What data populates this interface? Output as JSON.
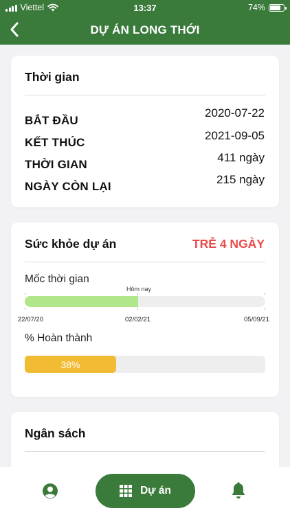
{
  "status_bar": {
    "carrier": "Viettel",
    "time": "13:37",
    "battery": "74%",
    "icons": [
      "signal-icon",
      "wifi-icon",
      "battery-icon"
    ]
  },
  "header": {
    "title": "DỰ ÁN LONG THỚI",
    "back_icon": "chevron-left-icon"
  },
  "time_card": {
    "title": "Thời gian",
    "rows": [
      {
        "label": "BẮT ĐẦU",
        "value": "2020-07-22"
      },
      {
        "label": "KẾT THÚC",
        "value": "2021-09-05"
      },
      {
        "label": "THỜI GIAN",
        "value": "411 ngày"
      },
      {
        "label": "NGÀY CÒN LẠI",
        "value": "215 ngày"
      }
    ]
  },
  "health_card": {
    "title": "Sức khỏe dự án",
    "status": "TRỄ 4 NGÀY",
    "timeline": {
      "label": "Mốc thời gian",
      "today_label": "Hôm nay",
      "start_date": "22/07/20",
      "today_date": "02/02/21",
      "end_date": "05/09/21",
      "elapsed_fraction": 0.47
    },
    "completion": {
      "label": "% Hoàn thành",
      "value_text": "38%",
      "percent": 38
    }
  },
  "budget_card": {
    "title": "Ngân sách"
  },
  "bottom_nav": {
    "projects_label": "Dự án",
    "icons": [
      "profile-icon",
      "grid-icon",
      "bell-icon"
    ]
  },
  "colors": {
    "primary_green": "#3a7a3a",
    "timeline_green": "#b2e68a",
    "progress_yellow": "#f1bb33",
    "late_red": "#e94b4b",
    "background": "#f2f2f4"
  }
}
